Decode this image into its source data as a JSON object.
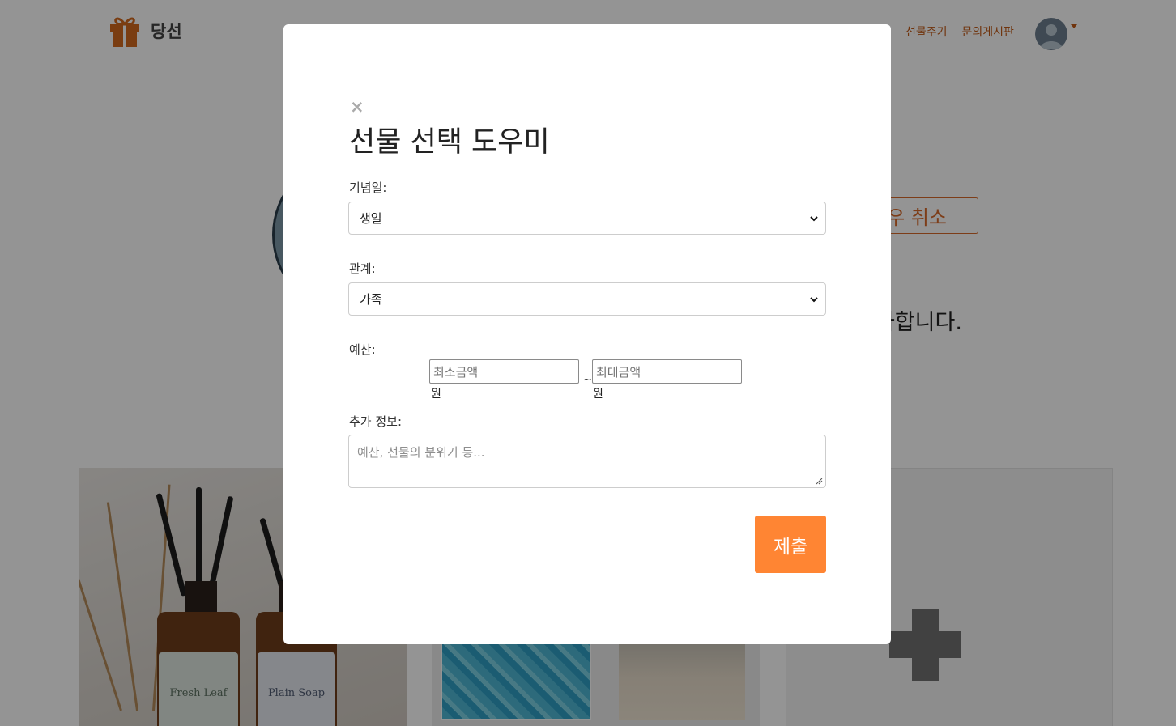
{
  "navbar": {
    "brand": "당선",
    "links": [
      "선물주기",
      "문의게시판"
    ],
    "partial_link": "기"
  },
  "background": {
    "cancel_button_label": "우 취소",
    "partial_text": "아합니다."
  },
  "products": [
    {
      "label_left": "Fresh Leaf",
      "label_right": "Plain Soap"
    }
  ],
  "modal": {
    "title": "선물 선택 도우미",
    "close_symbol": "×",
    "anniversary": {
      "label": "기념일:",
      "value": "생일"
    },
    "relationship": {
      "label": "관계:",
      "value": "가족"
    },
    "budget": {
      "label": "예산:",
      "min_placeholder": "최소금액",
      "max_placeholder": "최대금액",
      "unit": "원",
      "separator": "~"
    },
    "extra_info": {
      "label": "추가 정보:",
      "placeholder": "예산, 선물의 분위기 등..."
    },
    "submit_label": "제출"
  },
  "colors": {
    "accent": "#ff8533",
    "brand_text": "#c25a17",
    "overlay": "rgba(0,0,0,0.42)"
  }
}
